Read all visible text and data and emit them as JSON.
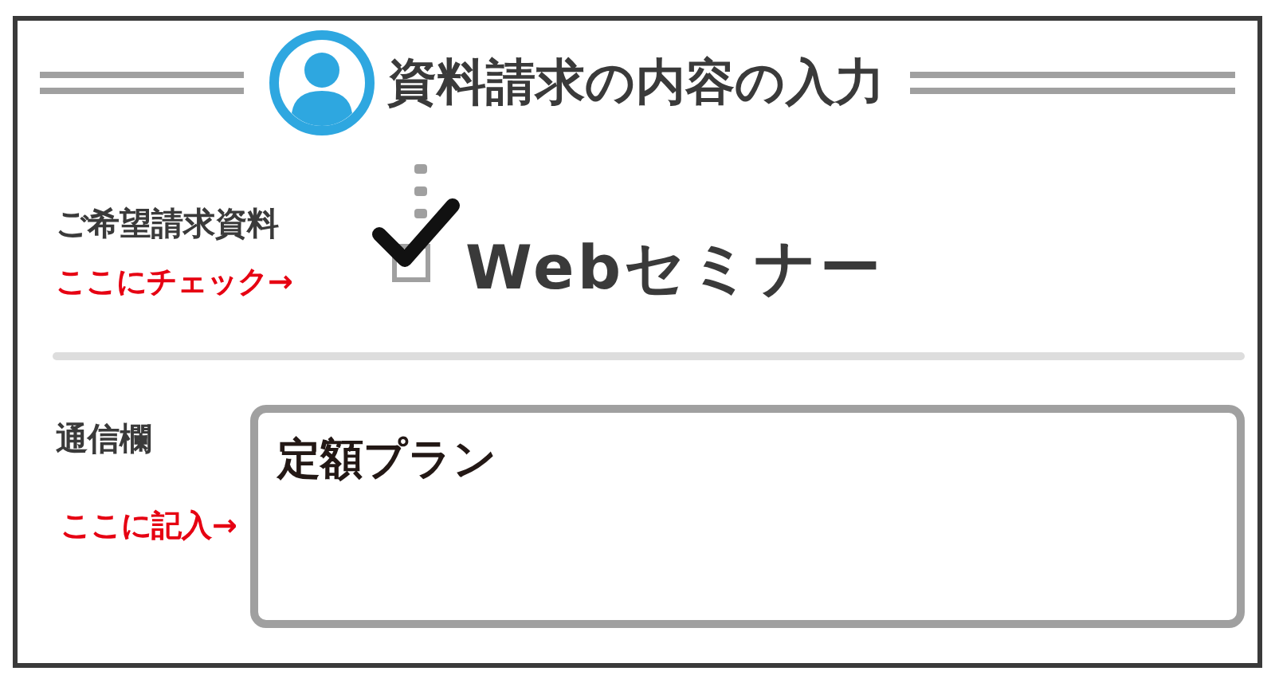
{
  "header": {
    "title": "資料請求の内容の入力"
  },
  "request": {
    "label": "ご希望請求資料",
    "hint": "ここにチェック→",
    "options": [
      {
        "label": "Webセミナー",
        "checked": true
      }
    ]
  },
  "message": {
    "label": "通信欄",
    "hint": "ここに記入→",
    "value": "定額プラン"
  }
}
